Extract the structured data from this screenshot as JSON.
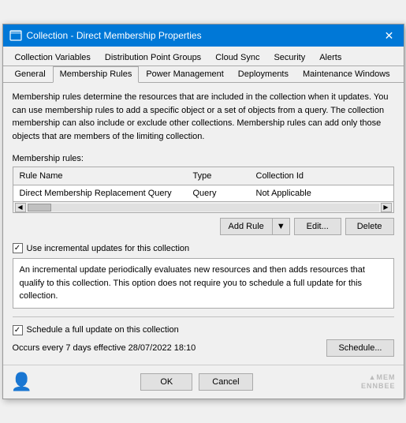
{
  "window": {
    "title": "Collection - Direct Membership Properties",
    "close_label": "✕"
  },
  "tabs_row1": {
    "items": [
      {
        "id": "collection-variables",
        "label": "Collection Variables"
      },
      {
        "id": "distribution-point-groups",
        "label": "Distribution Point Groups"
      },
      {
        "id": "cloud-sync",
        "label": "Cloud Sync"
      },
      {
        "id": "security",
        "label": "Security"
      },
      {
        "id": "alerts",
        "label": "Alerts"
      }
    ]
  },
  "tabs_row2": {
    "items": [
      {
        "id": "general",
        "label": "General"
      },
      {
        "id": "membership-rules",
        "label": "Membership Rules",
        "active": true
      },
      {
        "id": "power-management",
        "label": "Power Management"
      },
      {
        "id": "deployments",
        "label": "Deployments"
      },
      {
        "id": "maintenance-windows",
        "label": "Maintenance Windows"
      }
    ]
  },
  "description": "Membership rules determine the resources that are included in the collection when it updates. You can use membership rules to add a specific object or a set of objects from a query. The collection membership can also include or exclude other collections. Membership rules can add only those objects that are members of the limiting collection.",
  "membership_rules": {
    "label": "Membership rules:",
    "columns": [
      {
        "label": "Rule Name"
      },
      {
        "label": "Type"
      },
      {
        "label": "Collection Id"
      }
    ],
    "rows": [
      {
        "rule_name": "Direct Membership Replacement Query",
        "type": "Query",
        "collection_id": "Not Applicable"
      }
    ]
  },
  "buttons": {
    "add_rule": "Add Rule",
    "edit": "Edit...",
    "delete": "Delete"
  },
  "incremental_updates": {
    "checked": true,
    "label": "Use incremental updates for this collection",
    "description": "An incremental update periodically evaluates new resources and then adds resources that qualify to this collection. This option does not require you to schedule a full update for this collection."
  },
  "schedule_section": {
    "checked": true,
    "label": "Schedule a full update on this collection",
    "occurs_text": "Occurs every 7 days effective 28/07/2022 18:10",
    "schedule_button": "Schedule..."
  },
  "bottom": {
    "ok_label": "OK",
    "cancel_label": "Cancel",
    "watermark": "▲MEM\nENNBEE"
  }
}
